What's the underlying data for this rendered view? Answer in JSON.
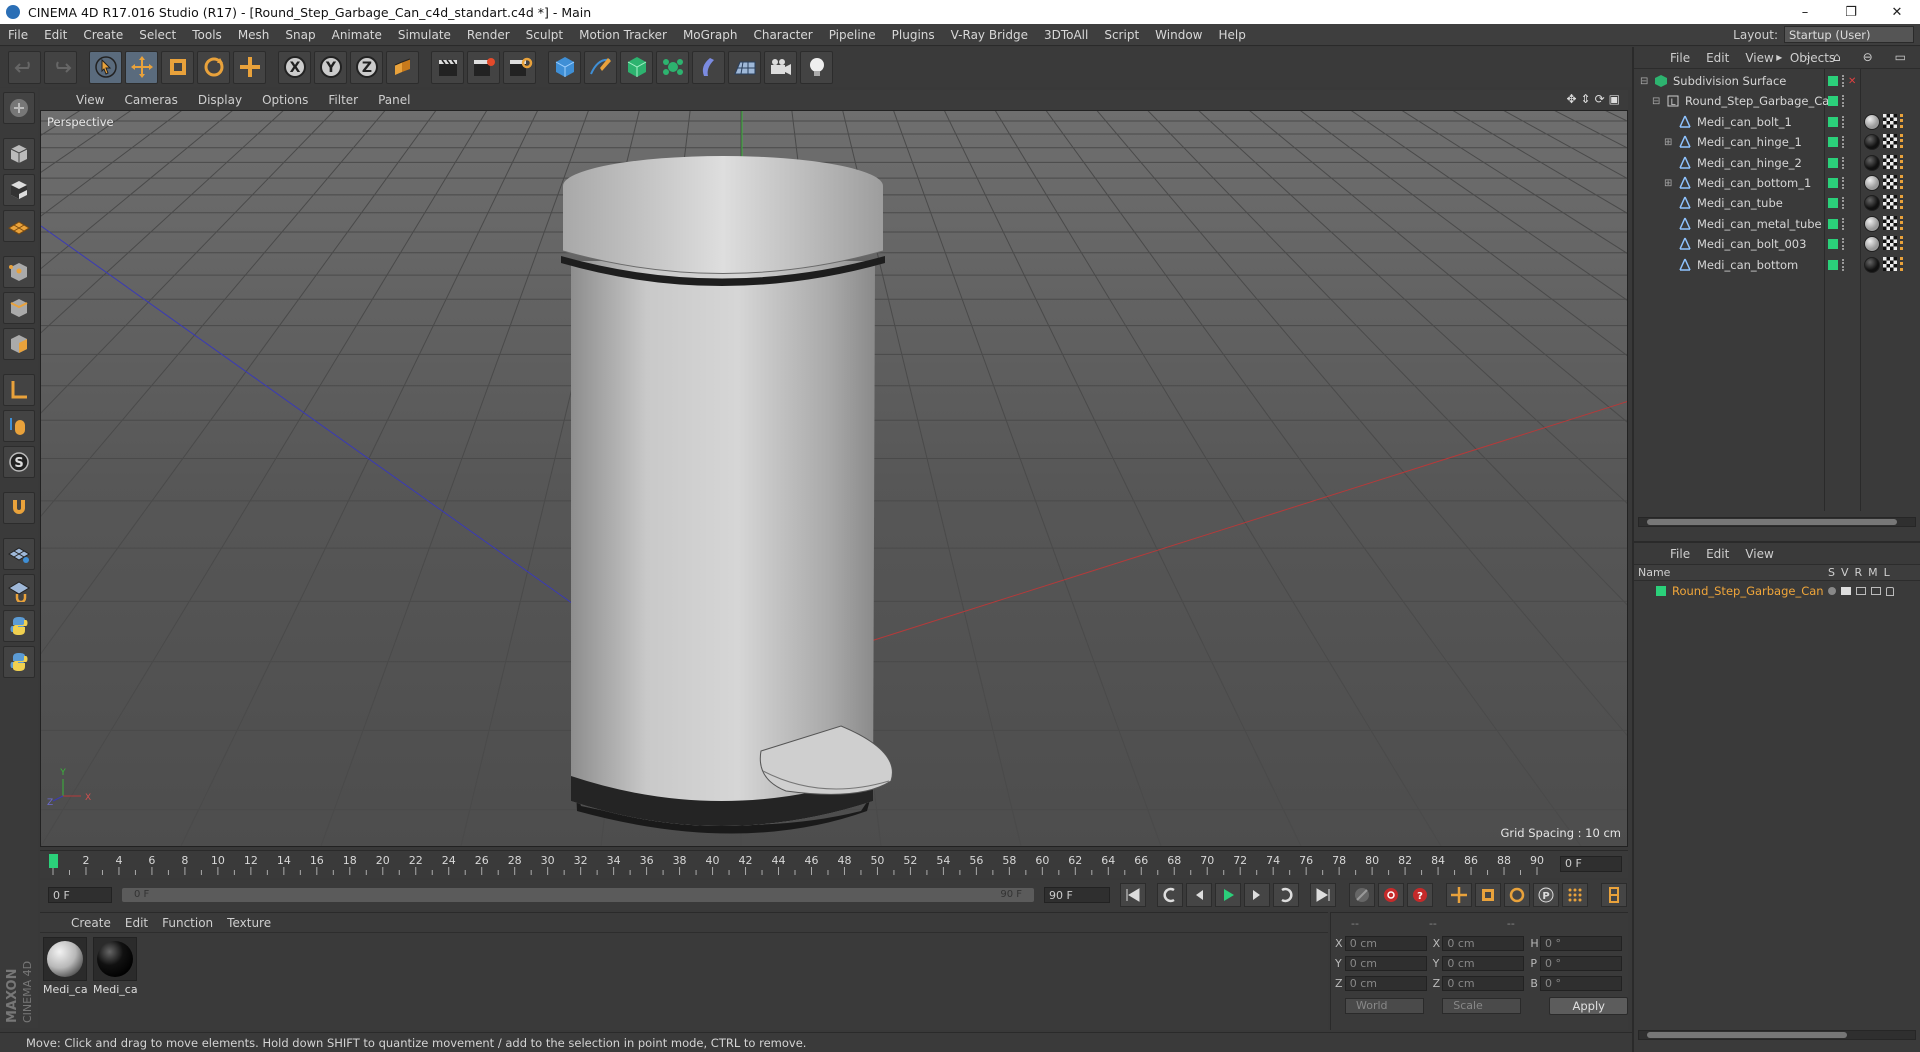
{
  "window": {
    "title": "CINEMA 4D R17.016 Studio (R17) - [Round_Step_Garbage_Can_c4d_standart.c4d *] - Main",
    "minimize": "–",
    "maximize": "❐",
    "close": "✕"
  },
  "menubar": {
    "items": [
      "File",
      "Edit",
      "Create",
      "Select",
      "Tools",
      "Mesh",
      "Snap",
      "Animate",
      "Simulate",
      "Render",
      "Sculpt",
      "Motion Tracker",
      "MoGraph",
      "Character",
      "Pipeline",
      "Plugins",
      "V-Ray Bridge",
      "3DToAll",
      "Script",
      "Window",
      "Help"
    ],
    "layout_label": "Layout:",
    "layout_value": "Startup (User)"
  },
  "viewport": {
    "menu": [
      "View",
      "Cameras",
      "Display",
      "Options",
      "Filter",
      "Panel"
    ],
    "camera_label": "Perspective",
    "grid_spacing": "Grid Spacing : 10 cm",
    "axis_labels": {
      "x": "X",
      "y": "Y",
      "z": "Z"
    }
  },
  "timeline": {
    "ticks": [
      0,
      2,
      4,
      6,
      8,
      10,
      12,
      14,
      16,
      18,
      20,
      22,
      24,
      26,
      28,
      30,
      32,
      34,
      36,
      38,
      40,
      42,
      44,
      46,
      48,
      50,
      52,
      54,
      56,
      58,
      60,
      62,
      64,
      66,
      68,
      70,
      72,
      74,
      76,
      78,
      80,
      82,
      84,
      86,
      88,
      90
    ],
    "current_frame_display": "0 F"
  },
  "transport": {
    "start_field": "0 F",
    "range_left": "0 F",
    "range_right": "90 F",
    "end_field": "90 F"
  },
  "material_manager": {
    "menu": [
      "Create",
      "Edit",
      "Function",
      "Texture"
    ],
    "materials": [
      {
        "name": "Medi_ca",
        "color": "#b8b8b8"
      },
      {
        "name": "Medi_ca",
        "color": "#111111"
      }
    ]
  },
  "coordinates": {
    "header": [
      "--",
      "--",
      "--"
    ],
    "rows": [
      {
        "a": "X",
        "av": "0 cm",
        "b": "X",
        "bv": "0 cm",
        "c": "H",
        "cv": "0 °"
      },
      {
        "a": "Y",
        "av": "0 cm",
        "b": "Y",
        "bv": "0 cm",
        "c": "P",
        "cv": "0 °"
      },
      {
        "a": "Z",
        "av": "0 cm",
        "b": "Z",
        "bv": "0 cm",
        "c": "B",
        "cv": "0 °"
      }
    ],
    "mode": "World",
    "transform": "Scale",
    "apply": "Apply"
  },
  "status": "Move: Click and drag to move elements. Hold down SHIFT to quantize movement / add to the selection in point mode, CTRL to remove.",
  "object_manager": {
    "menu": [
      "File",
      "Edit",
      "View",
      "Objects"
    ],
    "objects": [
      {
        "name": "Subdivision Surface",
        "indent": 0,
        "type": "subdiv",
        "mat": null
      },
      {
        "name": "Round_Step_Garbage_Can",
        "indent": 1,
        "type": "null",
        "mat": null
      },
      {
        "name": "Medi_can_bolt_1",
        "indent": 2,
        "type": "poly",
        "mat": "grey"
      },
      {
        "name": "Medi_can_hinge_1",
        "indent": 2,
        "type": "poly",
        "mat": "black",
        "expand": true
      },
      {
        "name": "Medi_can_hinge_2",
        "indent": 2,
        "type": "poly",
        "mat": "black"
      },
      {
        "name": "Medi_can_bottom_1",
        "indent": 2,
        "type": "poly",
        "mat": "grey",
        "expand": true
      },
      {
        "name": "Medi_can_tube",
        "indent": 2,
        "type": "poly",
        "mat": "black"
      },
      {
        "name": "Medi_can_metal_tube",
        "indent": 2,
        "type": "poly",
        "mat": "grey"
      },
      {
        "name": "Medi_can_bolt_003",
        "indent": 2,
        "type": "poly",
        "mat": "grey"
      },
      {
        "name": "Medi_can_bottom",
        "indent": 2,
        "type": "poly",
        "mat": "black"
      }
    ]
  },
  "layer_manager": {
    "menu": [
      "File",
      "Edit",
      "View"
    ],
    "header_name": "Name",
    "header_cols": [
      "S",
      "V",
      "R",
      "M",
      "L"
    ],
    "layers": [
      {
        "name": "Round_Step_Garbage_Can",
        "color": "#2bd07a"
      }
    ]
  },
  "colors": {
    "accent_orange": "#f0a63a",
    "tag_green": "#2bd07a",
    "panel": "#3a3a3a"
  }
}
